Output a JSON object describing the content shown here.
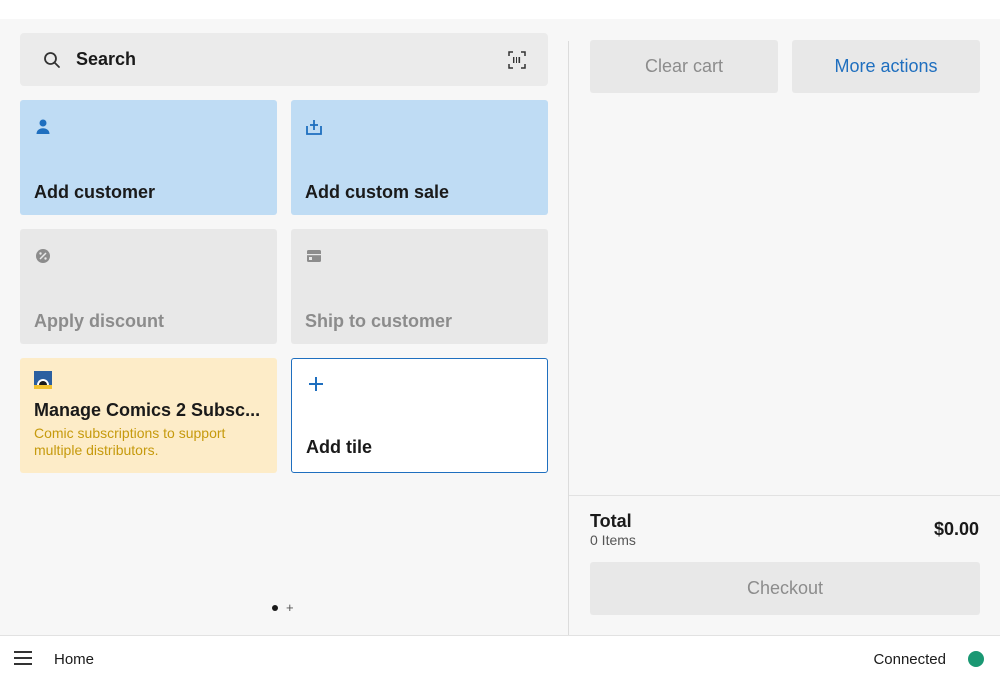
{
  "search": {
    "label": "Search",
    "icon": "search-icon",
    "scan_icon": "barcode-scan-icon"
  },
  "tiles": [
    {
      "label": "Add customer",
      "icon": "person-icon",
      "style": "blue"
    },
    {
      "label": "Add custom sale",
      "icon": "custom-sale-icon",
      "style": "blue"
    },
    {
      "label": "Apply discount",
      "icon": "discount-icon",
      "style": "gray"
    },
    {
      "label": "Ship to customer",
      "icon": "shipping-icon",
      "style": "gray"
    },
    {
      "title": "Manage Comics 2 Subsc...",
      "subtitle": "Comic subscriptions to support multiple distributors.",
      "icon": "app-logo-icon",
      "style": "yellow"
    },
    {
      "label": "Add tile",
      "icon": "plus-icon",
      "style": "add"
    }
  ],
  "pager": {
    "plus": "+"
  },
  "cart": {
    "clear_label": "Clear cart",
    "more_label": "More actions",
    "total_label": "Total",
    "items_label": "0 Items",
    "total_amount": "$0.00",
    "checkout_label": "Checkout"
  },
  "bottom": {
    "home_label": "Home",
    "status_label": "Connected",
    "status_color": "#1a9873"
  },
  "colors": {
    "accent": "#1f6fbf",
    "tile_blue": "#bfdcf4",
    "tile_yellow": "#fdecc8",
    "subtitle_yellow": "#c69a0d"
  }
}
